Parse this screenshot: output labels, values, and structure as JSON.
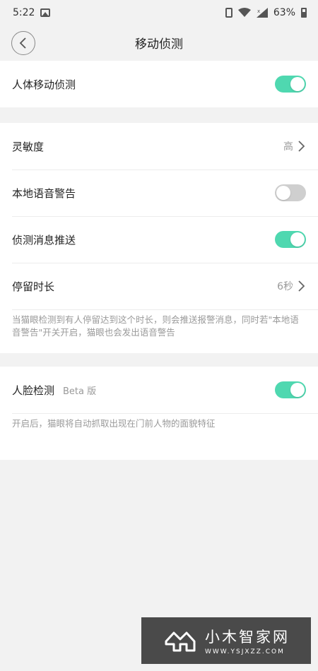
{
  "status_bar": {
    "time": "5:22",
    "battery": "63%"
  },
  "header": {
    "title": "移动侦测"
  },
  "section1": {
    "row_motion": {
      "label": "人体移动侦测",
      "toggle_on": true
    }
  },
  "section2": {
    "row_sensitivity": {
      "label": "灵敏度",
      "value": "高"
    },
    "row_voice_alert": {
      "label": "本地语音警告",
      "toggle_on": false
    },
    "row_push": {
      "label": "侦测消息推送",
      "toggle_on": true
    },
    "row_stay": {
      "label": "停留时长",
      "value": "6秒"
    },
    "note": "当猫眼检测到有人停留达到这个时长，则会推送报警消息，同时若\"本地语音警告\"开关开启，猫眼也会发出语音警告"
  },
  "section3": {
    "row_face": {
      "label": "人脸检测",
      "badge": "Beta 版",
      "toggle_on": true
    },
    "note": "开启后，猫眼将自动抓取出现在门前人物的面貌特征"
  },
  "watermark": {
    "title": "小木智家网",
    "url": "WWW.YSJXZZ.COM"
  },
  "colors": {
    "toggle_on": "#4fd8b0",
    "toggle_off": "#cfcfcf",
    "background": "#f2f2f2"
  }
}
